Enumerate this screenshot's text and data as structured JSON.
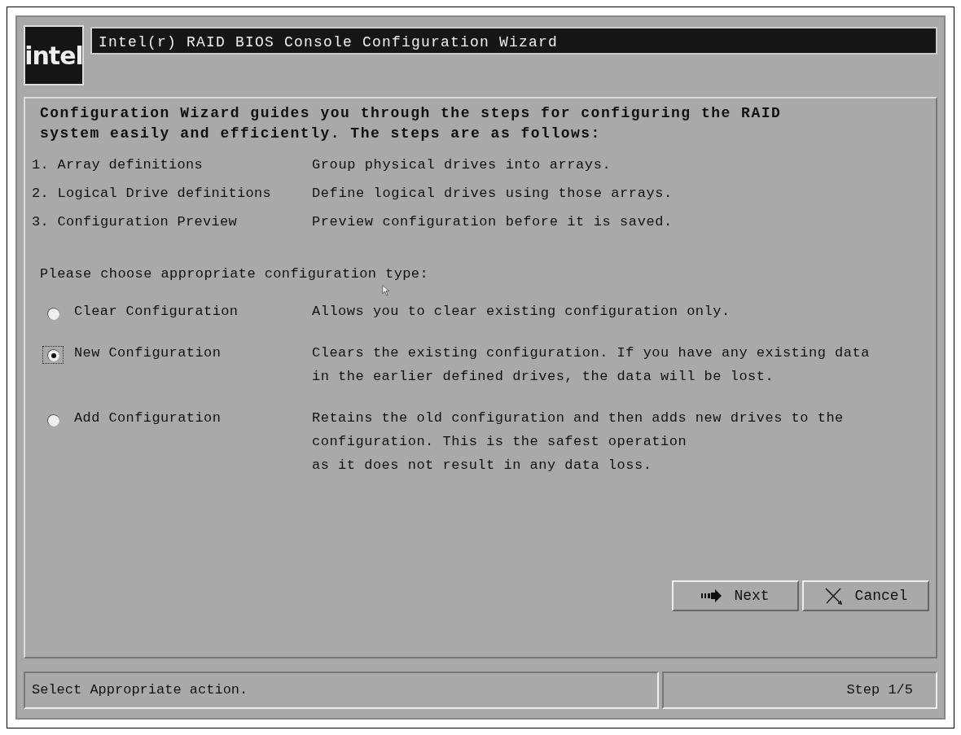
{
  "logo": "intel",
  "window": {
    "title": "Intel(r) RAID BIOS Console Configuration Wizard"
  },
  "intro": [
    "Configuration Wizard guides you through the steps for configuring the RAID",
    "system easily and efficiently. The steps are as follows:"
  ],
  "steps": [
    {
      "name": "1. Array definitions",
      "description": "Group physical drives into arrays."
    },
    {
      "name": "2. Logical Drive definitions",
      "description": "Define logical drives using those arrays."
    },
    {
      "name": "3. Configuration Preview",
      "description": "Preview configuration before it is saved."
    }
  ],
  "prompt": "Please choose appropriate configuration type:",
  "options": [
    {
      "label": "Clear Configuration",
      "selected": false,
      "focused": false,
      "description": [
        "Allows you to clear existing configuration only."
      ]
    },
    {
      "label": "New Configuration",
      "selected": true,
      "focused": true,
      "description": [
        "Clears the existing configuration. If you have any existing data",
        "in the earlier defined drives, the data will be lost."
      ]
    },
    {
      "label": "Add Configuration",
      "selected": false,
      "focused": false,
      "description": [
        "Retains the old configuration and then adds new drives to the",
        "configuration. This is the safest operation",
        "as it does not result in any data loss."
      ]
    }
  ],
  "buttons": [
    {
      "kind": "next",
      "label": "Next"
    },
    {
      "kind": "cancel",
      "label": "Cancel"
    }
  ],
  "status_bar": {
    "message": "Select Appropriate action.",
    "step": "Step 1/5"
  }
}
